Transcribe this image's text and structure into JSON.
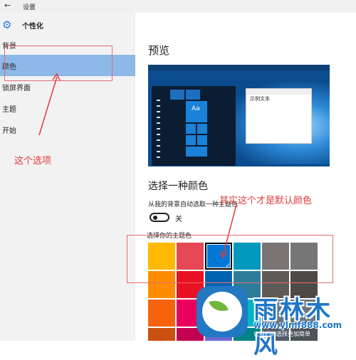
{
  "titlebar": {
    "back_icon": "back-arrow-icon",
    "back_glyph": "←",
    "title": "设置"
  },
  "header": {
    "icon": "gear-icon",
    "title": "个性化"
  },
  "sidebar": {
    "items": [
      {
        "label": "背景",
        "selected": false
      },
      {
        "label": "颜色",
        "selected": true
      },
      {
        "label": "锁屏界面",
        "selected": false
      },
      {
        "label": "主题",
        "selected": false
      },
      {
        "label": "开始",
        "selected": false
      }
    ]
  },
  "main": {
    "preview_heading": "预览",
    "preview_window_text": "示例文本",
    "preview_tile_text": "Aa",
    "choose_heading": "选择一种颜色",
    "auto_label": "从我的背景自动选取一种主题色",
    "toggle_state": "关",
    "theme_color_label": "选择你的主题色"
  },
  "swatches": [
    {
      "color": "#ffb900",
      "selected": false
    },
    {
      "color": "#e74856",
      "selected": false
    },
    {
      "color": "#0078d7",
      "selected": true
    },
    {
      "color": "#0099bc",
      "selected": false
    },
    {
      "color": "#7a7574",
      "selected": false
    },
    {
      "color": "#767676",
      "selected": false
    },
    {
      "color": "#ff8c00",
      "selected": false
    },
    {
      "color": "#e81123",
      "selected": false
    },
    {
      "color": "#0063b1",
      "selected": false
    },
    {
      "color": "#2d7d9a",
      "selected": false
    },
    {
      "color": "#5d5a58",
      "selected": false
    },
    {
      "color": "#4c4a48",
      "selected": false
    },
    {
      "color": "#f7630c",
      "selected": false
    },
    {
      "color": "#ea005e",
      "selected": false
    },
    {
      "color": "#8e8cd8",
      "selected": false
    },
    {
      "color": "#00b7c3",
      "selected": false
    },
    {
      "color": "#68768a",
      "selected": false
    },
    {
      "color": "#69797e",
      "selected": false
    },
    {
      "color": "#ca5010",
      "selected": false
    },
    {
      "color": "#c30052",
      "selected": false
    },
    {
      "color": "#6b69d6",
      "selected": false
    },
    {
      "color": "#038387",
      "selected": false
    },
    {
      "color": "#515c6b",
      "selected": false
    },
    {
      "color": "#4a5459",
      "selected": false
    }
  ],
  "annotations": {
    "option_note": "这个选项",
    "default_note": "其实这个才是默认颜色"
  },
  "watermark": {
    "brand": "雨林木风",
    "url": "www.ylmf888.com",
    "sub": "让我们的选择更加简单"
  },
  "colors": {
    "accent": "#0078d7",
    "selected_nav": "#8db8e8",
    "annotation": "#e03a3a"
  }
}
